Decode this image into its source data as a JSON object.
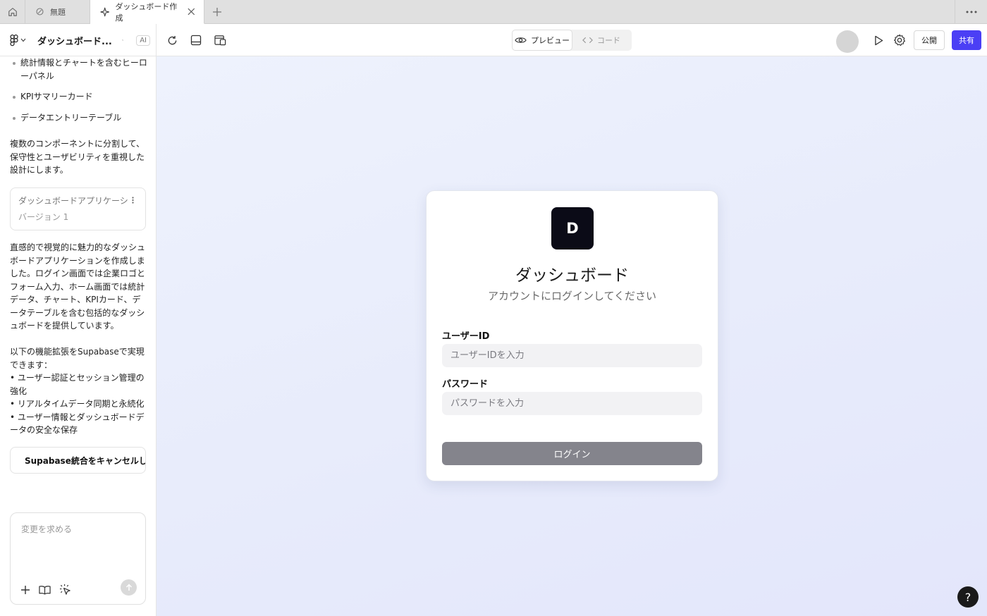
{
  "browser": {
    "tabs": [
      {
        "label": "無題"
      },
      {
        "label": "ダッシュボード作成"
      }
    ]
  },
  "toolbar": {
    "project_title": "ダッシュボード...",
    "ai_badge": "AI",
    "preview_label": "プレビュー",
    "code_label": "コード",
    "publish_label": "公開",
    "share_label": "共有",
    "accent_color": "#4b3ff5"
  },
  "sidebar": {
    "bullets": [
      "統計情報とチャートを含むヒーローパネル",
      "KPIサマリーカード",
      "データエントリーテーブル"
    ],
    "para1": "複数のコンポーネントに分割して、保守性とユーザビリティを重視した設計にします。",
    "version_card": {
      "title": "ダッシュボードアプリケーション",
      "subtitle": "バージョン 1"
    },
    "para2": "直感的で視覚的に魅力的なダッシュボードアプリケーションを作成しました。ログイン画面では企業ロゴとフォーム入力、ホーム画面では統計データ、チャート、KPIカード、データテーブルを含む包括的なダッシュボードを提供しています。",
    "para3_intro": "以下の機能拡張をSupabaseで実現できます：",
    "para3_items": [
      "• ユーザー認証とセッション管理の強化",
      "• リアルタイムデータ同期と永続化",
      "• ユーザー情報とダッシュボードデータの安全な保存"
    ],
    "cancel_button": "Supabase統合をキャンセルしま",
    "composer_placeholder": "変更を求める"
  },
  "preview": {
    "logo_letter": "D",
    "title": "ダッシュボード",
    "subtitle": "アカウントにログインしてください",
    "user_label": "ユーザーID",
    "user_placeholder": "ユーザーIDを入力",
    "password_label": "パスワード",
    "password_placeholder": "パスワードを入力",
    "login_button": "ログイン",
    "help": "?"
  }
}
